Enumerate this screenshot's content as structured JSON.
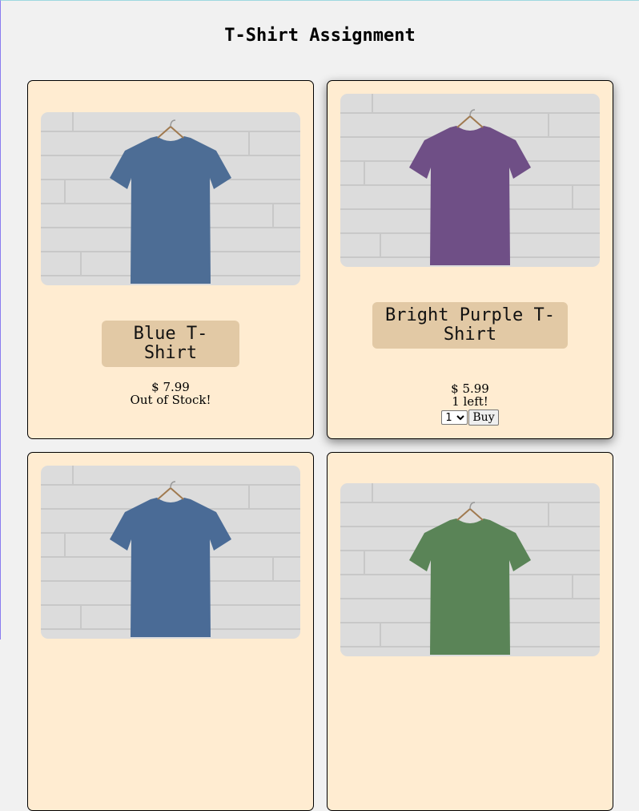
{
  "page": {
    "title": "T-Shirt Assignment"
  },
  "products": [
    {
      "name": "Blue T-Shirt",
      "price": "$ 7.99",
      "stock": "Out of Stock!",
      "shirt_color": "#4d6d95",
      "in_stock": false
    },
    {
      "name": "Bright Purple T-Shirt",
      "price": "$ 5.99",
      "stock": "1 left!",
      "shirt_color": "#6f4f86",
      "in_stock": true,
      "quantity_selected": "1",
      "buy_label": "Buy"
    },
    {
      "name": "",
      "shirt_color": "#4a6b96"
    },
    {
      "name": "",
      "shirt_color": "#5a8457"
    }
  ],
  "colors": {
    "card_bg": "#ffecd1",
    "name_tag_bg": "#e2c9a5",
    "page_bg": "#f1f1f1"
  }
}
